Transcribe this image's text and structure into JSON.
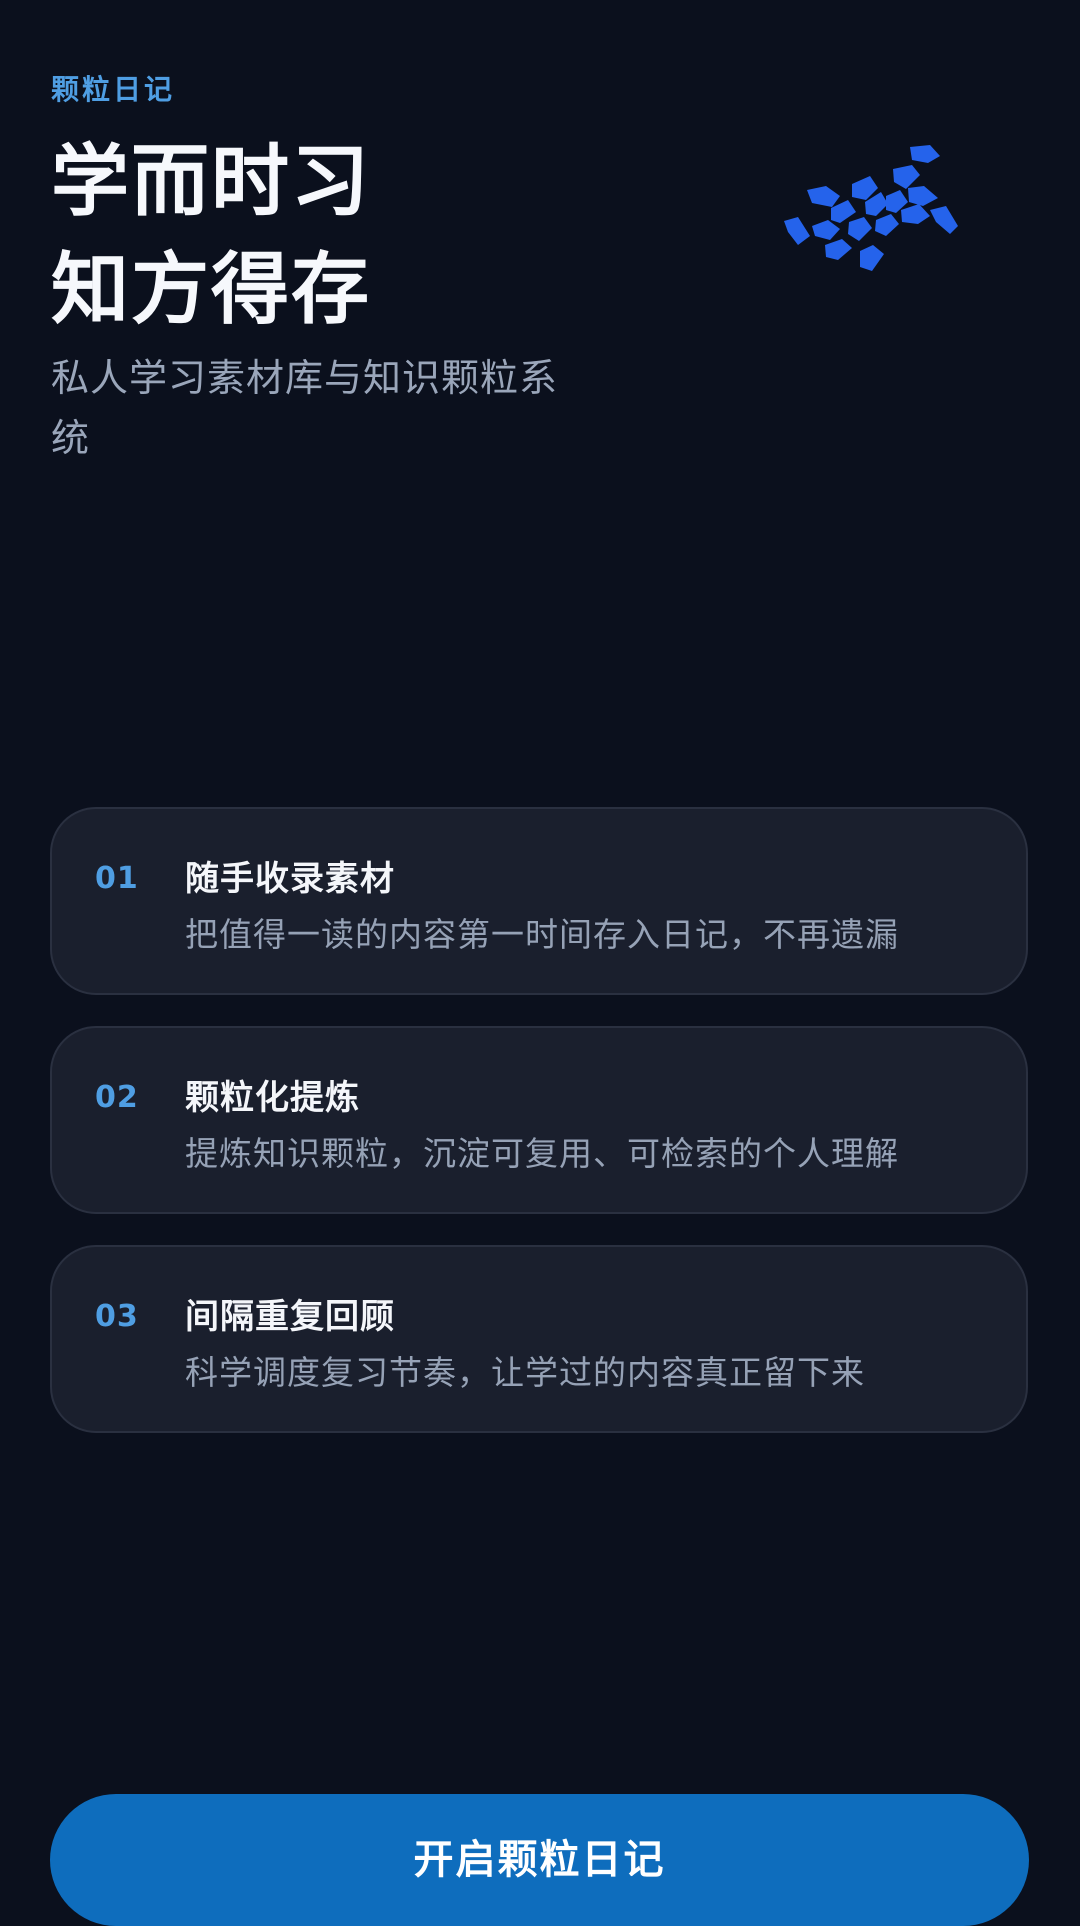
{
  "app": {
    "brand": "颗粒日记"
  },
  "hero": {
    "headline_line1": "学而时习",
    "headline_line2": "知方得存",
    "subtitle": "私人学习素材库与知识颗粒系统"
  },
  "logo": {
    "icon": "particle-cluster-icon",
    "color": "#2563eb"
  },
  "features": [
    {
      "number": "01",
      "title": "随手收录素材",
      "description": "把值得一读的内容第一时间存入日记，不再遗漏"
    },
    {
      "number": "02",
      "title": "颗粒化提炼",
      "description": "提炼知识颗粒，沉淀可复用、可检索的个人理解"
    },
    {
      "number": "03",
      "title": "间隔重复回顾",
      "description": "科学调度复习节奏，让学过的内容真正留下来"
    }
  ],
  "cta": {
    "label": "开启颗粒日记"
  },
  "colors": {
    "background": "#0b101d",
    "accent": "#4f9ee3",
    "card": "#1a1f2d",
    "button": "#0e6dbd"
  }
}
